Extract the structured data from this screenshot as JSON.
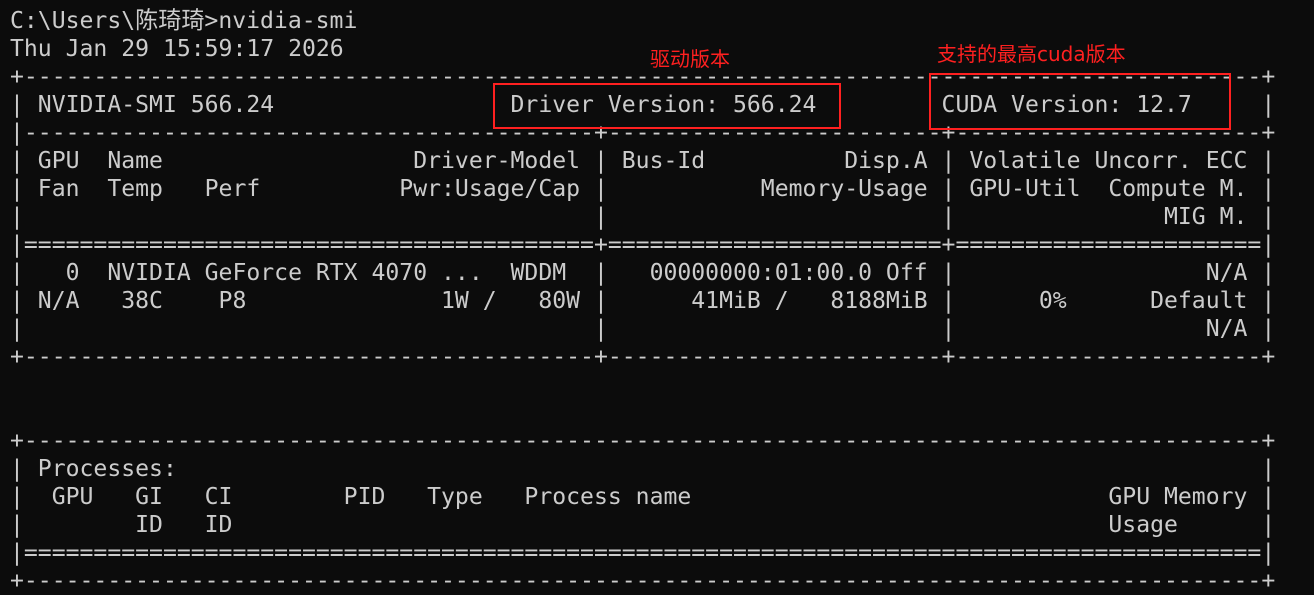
{
  "terminal": {
    "prompt": "C:\\Users\\陈琦琦>nvidia-smi",
    "timestamp": "Thu Jan 29 15:59:17 2026",
    "lines": [
      "+-----------------------------------------------------------------------------------------+",
      "| NVIDIA-SMI 566.24                 Driver Version: 566.24         CUDA Version: 12.7     |",
      "|-----------------------------------------+------------------------+----------------------+",
      "| GPU  Name                  Driver-Model | Bus-Id          Disp.A | Volatile Uncorr. ECC |",
      "| Fan  Temp   Perf          Pwr:Usage/Cap |           Memory-Usage | GPU-Util  Compute M. |",
      "|                                         |                        |               MIG M. |",
      "|=========================================+========================+======================|",
      "|   0  NVIDIA GeForce RTX 4070 ...  WDDM  |   00000000:01:00.0 Off |                  N/A |",
      "| N/A   38C    P8              1W /   80W |      41MiB /   8188MiB |      0%      Default |",
      "|                                         |                        |                  N/A |",
      "+-----------------------------------------+------------------------+----------------------+",
      "",
      "",
      "+-----------------------------------------------------------------------------------------+",
      "| Processes:                                                                              |",
      "|  GPU   GI   CI        PID   Type   Process name                              GPU Memory |",
      "|        ID   ID                                                               Usage      |",
      "|=========================================================================================|",
      "+-----------------------------------------------------------------------------------------+"
    ]
  },
  "annotations": {
    "driver_label": "驱动版本",
    "cuda_label": "支持的最高cuda版本"
  },
  "colors": {
    "background": "#0c0c0c",
    "text": "#cccccc",
    "annotation": "#ff2020"
  }
}
